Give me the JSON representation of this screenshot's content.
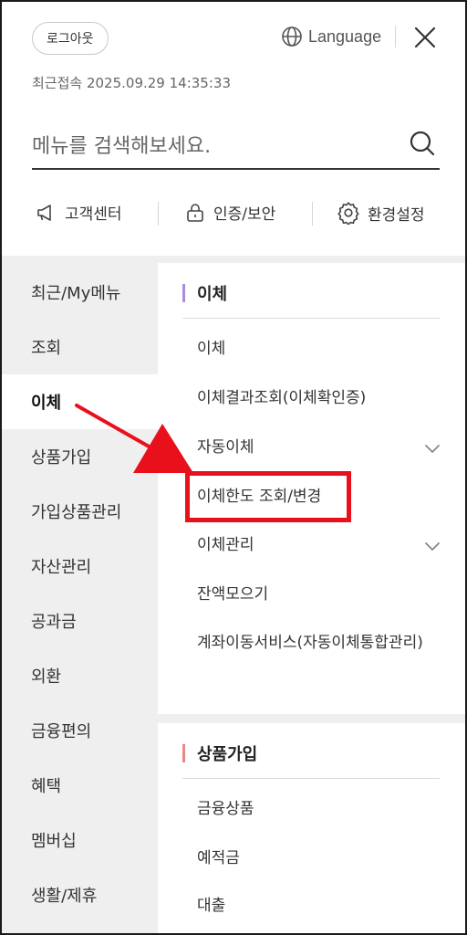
{
  "header": {
    "logout_label": "로그아웃",
    "language_label": "Language",
    "last_login": "최근접속 2025.09.29 14:35:33"
  },
  "search": {
    "placeholder": "메뉴를 검색해보세요."
  },
  "quick_links": [
    {
      "label": "고객센터",
      "icon": "megaphone-icon"
    },
    {
      "label": "인증/보안",
      "icon": "lock-icon"
    },
    {
      "label": "환경설정",
      "icon": "gear-icon"
    }
  ],
  "left_nav": {
    "active": "이체",
    "items": [
      "최근/My메뉴",
      "조회",
      "이체",
      "상품가입",
      "가입상품관리",
      "자산관리",
      "공과금",
      "외환",
      "금융편의",
      "혜택",
      "멤버십",
      "생활/제휴"
    ]
  },
  "sections": [
    {
      "title": "이체",
      "bar_color": "#a98be0",
      "items": [
        {
          "label": "이체",
          "expandable": false
        },
        {
          "label": "이체결과조회(이체확인증)",
          "expandable": false
        },
        {
          "label": "자동이체",
          "expandable": true
        },
        {
          "label": "이체한도 조회/변경",
          "expandable": false,
          "highlighted": true
        },
        {
          "label": "이체관리",
          "expandable": true
        },
        {
          "label": "잔액모으기",
          "expandable": false
        },
        {
          "label": "계좌이동서비스(자동이체통합관리)",
          "expandable": false
        }
      ]
    },
    {
      "title": "상품가입",
      "bar_color": "#e8868a",
      "items": [
        {
          "label": "금융상품",
          "expandable": false
        },
        {
          "label": "예적금",
          "expandable": false
        },
        {
          "label": "대출",
          "expandable": false
        }
      ]
    }
  ],
  "annotation": {
    "highlight_color": "#e8101a"
  }
}
